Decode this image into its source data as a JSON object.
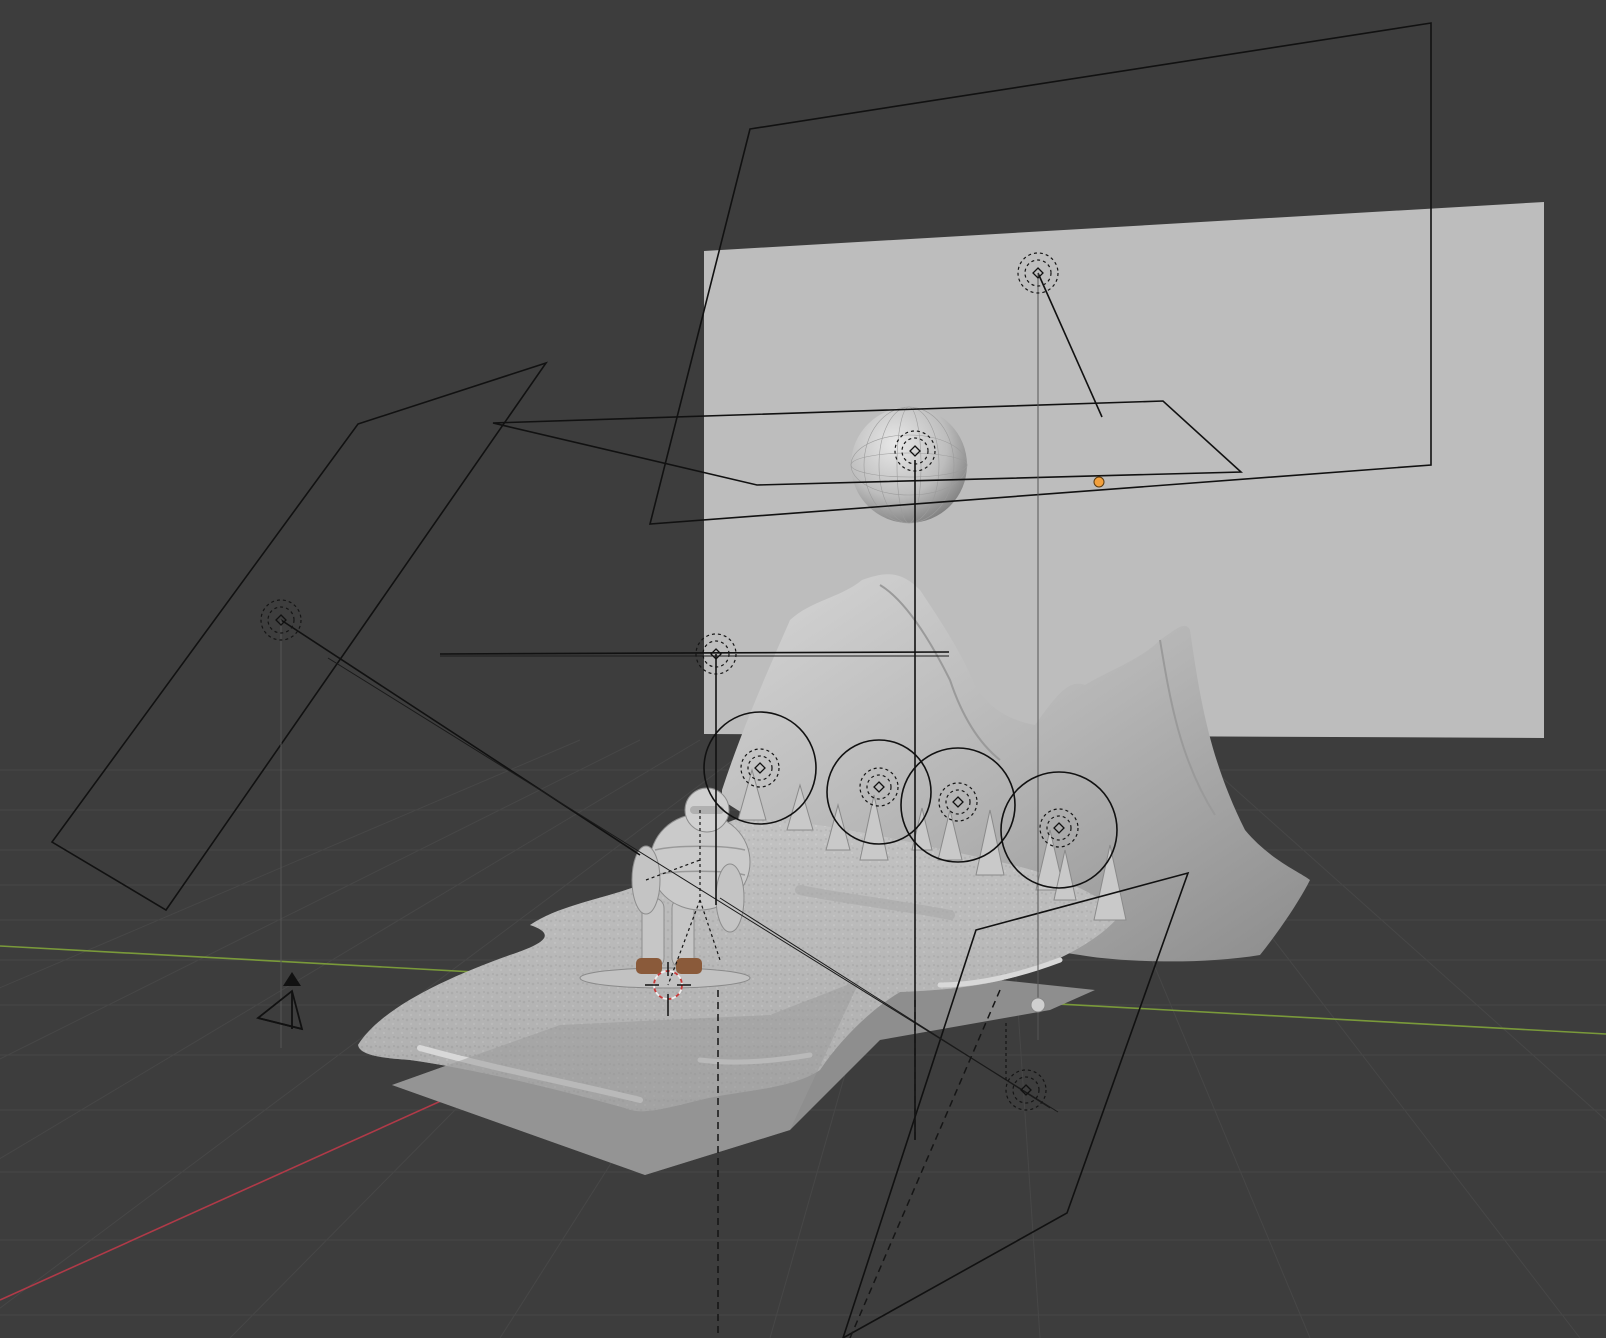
{
  "editor": {
    "type": "3D Viewport",
    "shading": "solid",
    "overlays": {
      "floor_grid": true,
      "x_axis": true,
      "y_axis": true,
      "lights_wireframes": true,
      "camera_wireframe": true
    },
    "colors": {
      "background": "#3d3d3d",
      "grid_line": "#474747",
      "x_axis": "#b03a48",
      "y_axis": "#7a9a3a",
      "selection_origin": "#f2a03d",
      "solid_surface": "#c4c4c4",
      "backdrop_plane": "#bdbdbd"
    }
  },
  "scene_objects": [
    {
      "name": "backdrop-plane",
      "kind": "mesh",
      "icon": "plane"
    },
    {
      "name": "moon-sphere",
      "kind": "mesh",
      "icon": "sphere"
    },
    {
      "name": "mountain-range",
      "kind": "mesh",
      "icon": "mesh"
    },
    {
      "name": "snow-ground",
      "kind": "mesh",
      "icon": "mesh"
    },
    {
      "name": "pine-trees",
      "kind": "mesh",
      "icon": "mesh"
    },
    {
      "name": "snowboarder-character",
      "kind": "mesh",
      "icon": "mesh"
    },
    {
      "name": "area-light-top",
      "kind": "light",
      "icon": "light-area"
    },
    {
      "name": "area-light-left",
      "kind": "light",
      "icon": "light-area"
    },
    {
      "name": "area-light-right",
      "kind": "light",
      "icon": "light-area"
    },
    {
      "name": "area-light-center",
      "kind": "light",
      "icon": "light-area"
    },
    {
      "name": "point-lights",
      "kind": "light",
      "icon": "light-point"
    },
    {
      "name": "scene-camera",
      "kind": "camera",
      "icon": "camera"
    },
    {
      "name": "3d-cursor",
      "kind": "cursor",
      "icon": "cursor"
    }
  ]
}
